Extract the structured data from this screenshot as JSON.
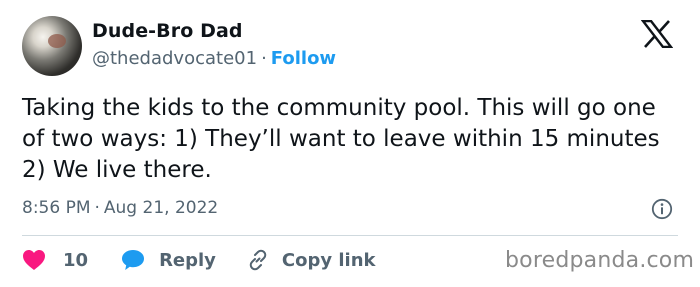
{
  "author": {
    "display_name": "Dude-Bro Dad",
    "handle": "@thedadvocate01",
    "separator": "·",
    "follow_label": "Follow"
  },
  "tweet": {
    "text": "Taking the kids to the community pool. This will go one of two ways: 1) They’ll want to leave within 15 minutes 2) We live there.",
    "time": "8:56 PM",
    "separator": "·",
    "date": "Aug 21, 2022"
  },
  "actions": {
    "like_count": "10",
    "reply_label": "Reply",
    "copy_link_label": "Copy link"
  },
  "watermark": "boredpanda.com",
  "icons": {
    "logo": "x-logo-icon",
    "info": "info-icon",
    "like": "heart-icon",
    "reply": "speech-bubble-icon",
    "copy": "link-icon"
  },
  "colors": {
    "accent": "#1d9bf0",
    "like": "#f91880",
    "secondary_text": "#536471",
    "primary_text": "#0f1419"
  }
}
